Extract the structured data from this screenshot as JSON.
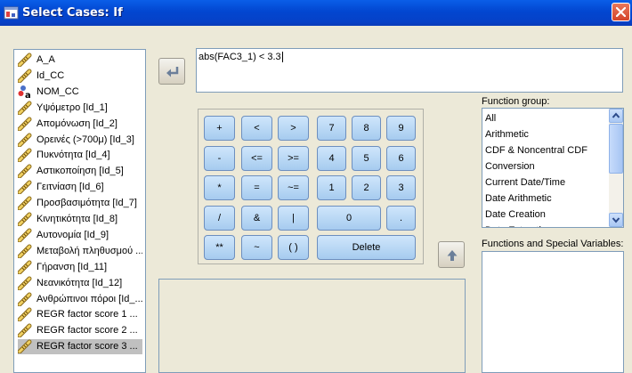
{
  "window": {
    "title": "Select Cases: If"
  },
  "variables": [
    {
      "label": "A_A",
      "icon": "ruler-icon"
    },
    {
      "label": "Id_CC",
      "icon": "ruler-icon"
    },
    {
      "label": "NOM_CC",
      "icon": "nominal-string-icon"
    },
    {
      "label": "Υψόμετρο [Id_1]",
      "icon": "ruler-icon"
    },
    {
      "label": "Απομόνωση [Id_2]",
      "icon": "ruler-icon"
    },
    {
      "label": "Ορεινές (>700μ) [Id_3]",
      "icon": "ruler-icon"
    },
    {
      "label": "Πυκνότητα [Id_4]",
      "icon": "ruler-icon"
    },
    {
      "label": "Αστικοποίηση [Id_5]",
      "icon": "ruler-icon"
    },
    {
      "label": "Γειτνίαση [Id_6]",
      "icon": "ruler-icon"
    },
    {
      "label": "Προσβασιμότητα [Id_7]",
      "icon": "ruler-icon"
    },
    {
      "label": "Κινητικότητα [Id_8]",
      "icon": "ruler-icon"
    },
    {
      "label": "Αυτονομία [Id_9]",
      "icon": "ruler-icon"
    },
    {
      "label": "Μεταβολή πληθυσμού ...",
      "icon": "ruler-icon"
    },
    {
      "label": "Γήρανση [Id_11]",
      "icon": "ruler-icon"
    },
    {
      "label": "Νεανικότητα [Id_12]",
      "icon": "ruler-icon"
    },
    {
      "label": "Ανθρώπινοι πόροι [Id_...",
      "icon": "ruler-icon"
    },
    {
      "label": "REGR factor score  1 ...",
      "icon": "ruler-icon"
    },
    {
      "label": "REGR factor score  2 ...",
      "icon": "ruler-icon"
    },
    {
      "label": "REGR factor score  3 ...",
      "icon": "ruler-icon"
    }
  ],
  "selected_variable_index": 18,
  "expression": {
    "value": "abs(FAC3_1) < 3.3"
  },
  "keypad": {
    "plus": "+",
    "lt": "<",
    "gt": ">",
    "n7": "7",
    "n8": "8",
    "n9": "9",
    "minus": "-",
    "le": "<=",
    "ge": ">=",
    "n4": "4",
    "n5": "5",
    "n6": "6",
    "mul": "*",
    "eq": "=",
    "ne": "~=",
    "n1": "1",
    "n2": "2",
    "n3": "3",
    "div": "/",
    "and": "&",
    "or": "|",
    "n0": "0",
    "dot": ".",
    "pow": "**",
    "not": "~",
    "parens": "( )",
    "delete": "Delete"
  },
  "function_group": {
    "label": "Function group:",
    "items": [
      "All",
      "Arithmetic",
      "CDF & Noncentral CDF",
      "Conversion",
      "Current Date/Time",
      "Date Arithmetic",
      "Date Creation",
      "Date Extraction"
    ]
  },
  "functions_special": {
    "label": "Functions and Special Variables:"
  },
  "colors": {
    "title_bar": "#0054e3",
    "button_face": "#b9d7f5",
    "dialog_bg": "#ece9d8",
    "close": "#d6533a"
  }
}
